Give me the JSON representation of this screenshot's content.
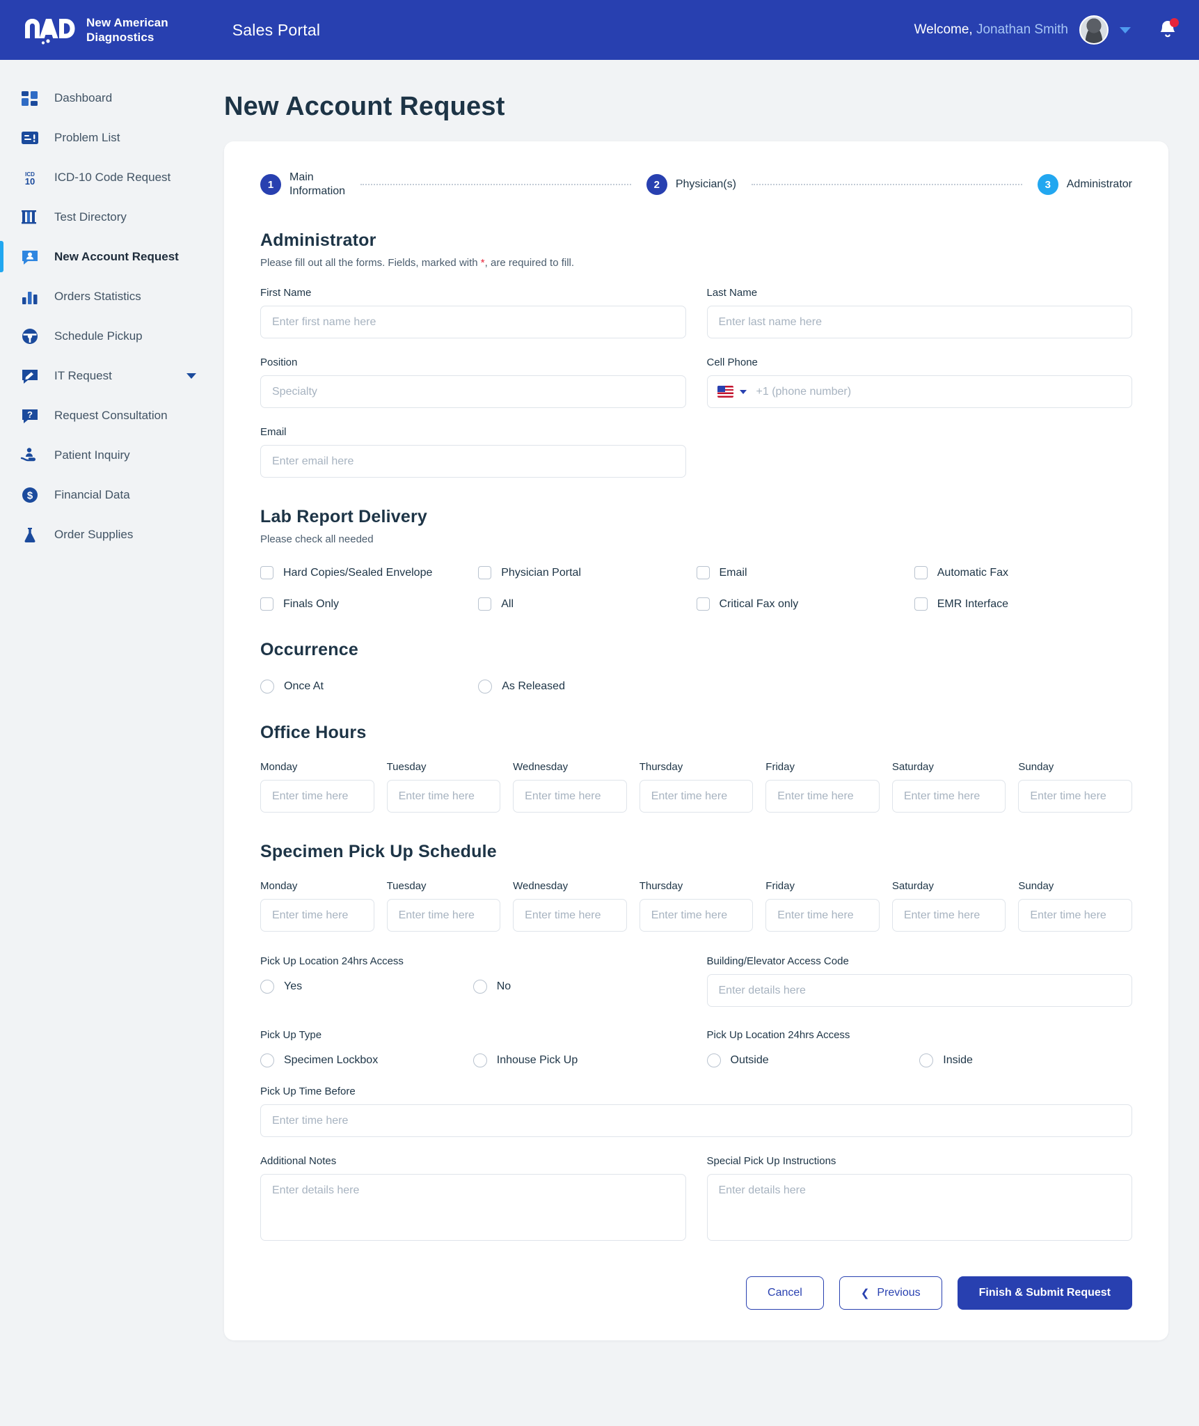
{
  "header": {
    "brand_line1": "New American",
    "brand_line2": "Diagnostics",
    "portal_title": "Sales Portal",
    "welcome_prefix": "Welcome, ",
    "user_name": "Jonathan Smith",
    "brand_color": "#2840b0",
    "accent_color": "#22a7f0"
  },
  "sidebar": {
    "items": [
      {
        "label": "Dashboard",
        "icon": "dashboard-icon",
        "active": false,
        "has_caret": false
      },
      {
        "label": "Problem List",
        "icon": "problem-list-icon",
        "active": false,
        "has_caret": false
      },
      {
        "label": "ICD-10 Code Request",
        "icon": "icd10-icon",
        "active": false,
        "has_caret": false
      },
      {
        "label": "Test Directory",
        "icon": "test-directory-icon",
        "active": false,
        "has_caret": false
      },
      {
        "label": "New Account Request",
        "icon": "new-account-icon",
        "active": true,
        "has_caret": false
      },
      {
        "label": "Orders Statistics",
        "icon": "bar-chart-icon",
        "active": false,
        "has_caret": false
      },
      {
        "label": "Schedule Pickup",
        "icon": "steering-wheel-icon",
        "active": false,
        "has_caret": false
      },
      {
        "label": "IT Request",
        "icon": "it-request-icon",
        "active": false,
        "has_caret": true
      },
      {
        "label": "Request Consultation",
        "icon": "question-bubble-icon",
        "active": false,
        "has_caret": false
      },
      {
        "label": "Patient Inquiry",
        "icon": "patient-inquiry-icon",
        "active": false,
        "has_caret": false
      },
      {
        "label": "Financial Data",
        "icon": "dollar-coin-icon",
        "active": false,
        "has_caret": false
      },
      {
        "label": "Order Supplies",
        "icon": "flask-icon",
        "active": false,
        "has_caret": false
      }
    ]
  },
  "page": {
    "title": "New Account Request"
  },
  "stepper": {
    "steps": [
      {
        "number": "1",
        "label": "Main\nInformation",
        "state": "done"
      },
      {
        "number": "2",
        "label": "Physician(s)",
        "state": "done"
      },
      {
        "number": "3",
        "label": "Administrator",
        "state": "current"
      }
    ]
  },
  "form": {
    "heading": "Administrator",
    "subtitle_before": "Please fill out all the forms. Fields, marked with ",
    "subtitle_star": "*",
    "subtitle_after": ", are required to fill.",
    "first_name": {
      "label": "First Name",
      "placeholder": "Enter first name here",
      "value": ""
    },
    "last_name": {
      "label": "Last Name",
      "placeholder": "Enter last name here",
      "value": ""
    },
    "position": {
      "label": "Position",
      "placeholder": "Specialty",
      "value": ""
    },
    "cell_phone": {
      "label": "Cell Phone",
      "placeholder": "+1 (phone number)",
      "value": "",
      "country": "US"
    },
    "email": {
      "label": "Email",
      "placeholder": "Enter email here",
      "value": ""
    }
  },
  "lab_report_delivery": {
    "title": "Lab Report Delivery",
    "subtitle": "Please check all needed",
    "options": [
      {
        "label": "Hard Copies/Sealed Envelope",
        "checked": false
      },
      {
        "label": "Physician Portal",
        "checked": false
      },
      {
        "label": "Email",
        "checked": false
      },
      {
        "label": "Automatic Fax",
        "checked": false
      },
      {
        "label": "Finals Only",
        "checked": false
      },
      {
        "label": "All",
        "checked": false
      },
      {
        "label": "Critical Fax only",
        "checked": false
      },
      {
        "label": "EMR Interface",
        "checked": false
      }
    ]
  },
  "occurrence": {
    "title": "Occurrence",
    "options": [
      {
        "label": "Once At",
        "selected": false
      },
      {
        "label": "As Released",
        "selected": false
      }
    ]
  },
  "office_hours": {
    "title": "Office Hours",
    "days": [
      {
        "label": "Monday",
        "placeholder": "Enter time here",
        "value": ""
      },
      {
        "label": "Tuesday",
        "placeholder": "Enter time here",
        "value": ""
      },
      {
        "label": "Wednesday",
        "placeholder": "Enter time here",
        "value": ""
      },
      {
        "label": "Thursday",
        "placeholder": "Enter time here",
        "value": ""
      },
      {
        "label": "Friday",
        "placeholder": "Enter time here",
        "value": ""
      },
      {
        "label": "Saturday",
        "placeholder": "Enter time here",
        "value": ""
      },
      {
        "label": "Sunday",
        "placeholder": "Enter time here",
        "value": ""
      }
    ]
  },
  "specimen_schedule": {
    "title": "Specimen Pick Up Schedule",
    "days": [
      {
        "label": "Monday",
        "placeholder": "Enter time here",
        "value": ""
      },
      {
        "label": "Tuesday",
        "placeholder": "Enter time here",
        "value": ""
      },
      {
        "label": "Wednesday",
        "placeholder": "Enter time here",
        "value": ""
      },
      {
        "label": "Thursday",
        "placeholder": "Enter time here",
        "value": ""
      },
      {
        "label": "Friday",
        "placeholder": "Enter time here",
        "value": ""
      },
      {
        "label": "Saturday",
        "placeholder": "Enter time here",
        "value": ""
      },
      {
        "label": "Sunday",
        "placeholder": "Enter time here",
        "value": ""
      }
    ],
    "access_24hrs": {
      "label": "Pick Up Location 24hrs Access",
      "options": [
        {
          "label": "Yes",
          "selected": false
        },
        {
          "label": "No",
          "selected": false
        }
      ]
    },
    "access_code": {
      "label": "Building/Elevator Access Code",
      "placeholder": "Enter details here",
      "value": ""
    },
    "pick_up_type": {
      "label": "Pick Up Type",
      "options": [
        {
          "label": "Specimen Lockbox",
          "selected": false
        },
        {
          "label": "Inhouse Pick Up",
          "selected": false
        }
      ]
    },
    "location_access": {
      "label": "Pick Up Location 24hrs Access",
      "options": [
        {
          "label": "Outside",
          "selected": false
        },
        {
          "label": "Inside",
          "selected": false
        }
      ]
    },
    "time_before": {
      "label": "Pick Up Time Before",
      "placeholder": "Enter time here",
      "value": ""
    },
    "additional_notes": {
      "label": "Additional Notes",
      "placeholder": "Enter details here",
      "value": ""
    },
    "special_instructions": {
      "label": "Special Pick Up Instructions",
      "placeholder": "Enter details here",
      "value": ""
    }
  },
  "actions": {
    "cancel": "Cancel",
    "previous": "Previous",
    "submit": "Finish & Submit Request"
  }
}
